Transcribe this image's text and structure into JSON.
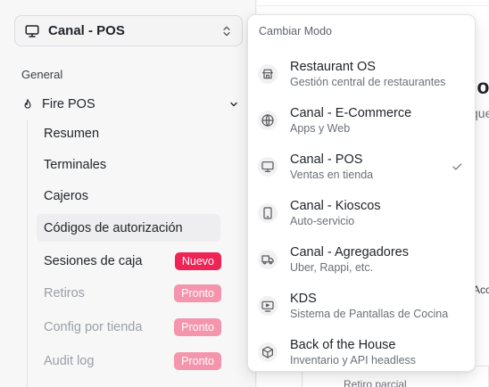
{
  "mode_switch": {
    "label": "Canal - POS"
  },
  "sidebar": {
    "section_label": "General",
    "group": {
      "label": "Fire POS"
    },
    "items": [
      {
        "label": "Resumen",
        "badge": ""
      },
      {
        "label": "Terminales",
        "badge": ""
      },
      {
        "label": "Cajeros",
        "badge": ""
      },
      {
        "label": "Códigos de autorización",
        "badge": ""
      },
      {
        "label": "Sesiones de caja",
        "badge": "Nuevo"
      },
      {
        "label": "Retiros",
        "badge": "Pronto"
      },
      {
        "label": "Config por tienda",
        "badge": "Pronto"
      },
      {
        "label": "Audit log",
        "badge": "Pronto"
      }
    ]
  },
  "background": {
    "heading_fragment": "io",
    "sub_fragment": "que",
    "acc_fragment": "Acc",
    "retiro_label": "Retiro parcial"
  },
  "dropdown": {
    "heading": "Cambiar Modo",
    "options": [
      {
        "title": "Restaurant OS",
        "desc": "Gestión central de restaurantes",
        "icon": "store-icon",
        "selected": false
      },
      {
        "title": "Canal - E-Commerce",
        "desc": "Apps y Web",
        "icon": "globe-icon",
        "selected": false
      },
      {
        "title": "Canal - POS",
        "desc": "Ventas en tienda",
        "icon": "monitor-icon",
        "selected": true
      },
      {
        "title": "Canal - Kioscos",
        "desc": "Auto-servicio",
        "icon": "tablet-icon",
        "selected": false
      },
      {
        "title": "Canal - Agregadores",
        "desc": "Uber, Rappi, etc.",
        "icon": "truck-icon",
        "selected": false
      },
      {
        "title": "KDS",
        "desc": "Sistema de Pantallas de Cocina",
        "icon": "screen-play-icon",
        "selected": false
      },
      {
        "title": "Back of the House",
        "desc": "Inventario y API headless",
        "icon": "package-icon",
        "selected": false
      }
    ]
  },
  "colors": {
    "badge_new": "#ee2456",
    "badge_soon": "#f495ad",
    "icon_bg": "#f1f1f3"
  }
}
